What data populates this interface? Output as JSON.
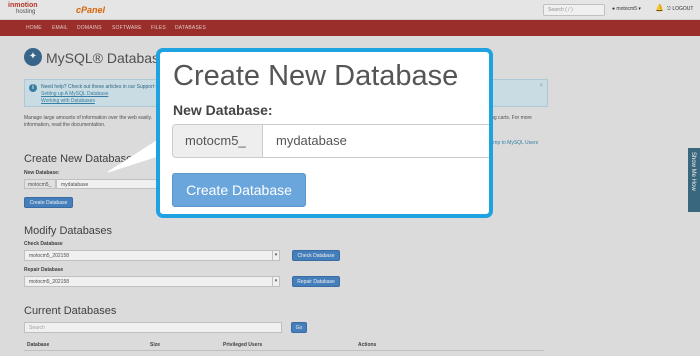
{
  "topbar": {
    "brand_top": "inmotion",
    "brand_sub": "hosting",
    "cpanel": "cPanel",
    "search_placeholder": "Search ( / )",
    "user": "motocm5",
    "logout": "LOGOUT"
  },
  "nav": {
    "items": [
      "HOME",
      "EMAIL",
      "DOMAINS",
      "SOFTWARE",
      "FILES",
      "DATABASES"
    ]
  },
  "page": {
    "title": "MySQL® Databases",
    "help_title": "Need help? Check out these articles in our Support Center:",
    "help_links": [
      "Setting up A MySQL Database",
      "Working with Databases"
    ],
    "intro_line1": "Manage large amounts of information over the web easily.",
    "intro_line2": "information, read the documentation.",
    "intro_right": "ing carts. For more",
    "users_link": "Jump to MySQL Users"
  },
  "create": {
    "heading": "Create New Database",
    "label": "New Database:",
    "prefix": "motocm5_",
    "value": "mydatabase",
    "button": "Create Database"
  },
  "modify": {
    "heading": "Modify Databases",
    "check_label": "Check Database",
    "check_value": "motocm5_202158",
    "check_button": "Check Database",
    "repair_label": "Repair Database",
    "repair_value": "motocm5_202158",
    "repair_button": "Repair Database"
  },
  "current": {
    "heading": "Current Databases",
    "search_placeholder": "Search",
    "go": "Go",
    "columns": [
      "Database",
      "Size",
      "Privileged Users",
      "Actions"
    ]
  },
  "side_tab": "Show Me How",
  "colors": {
    "nav": "#a3312d",
    "callout_border": "#1fa3e0",
    "button": "#6aa6dc"
  }
}
